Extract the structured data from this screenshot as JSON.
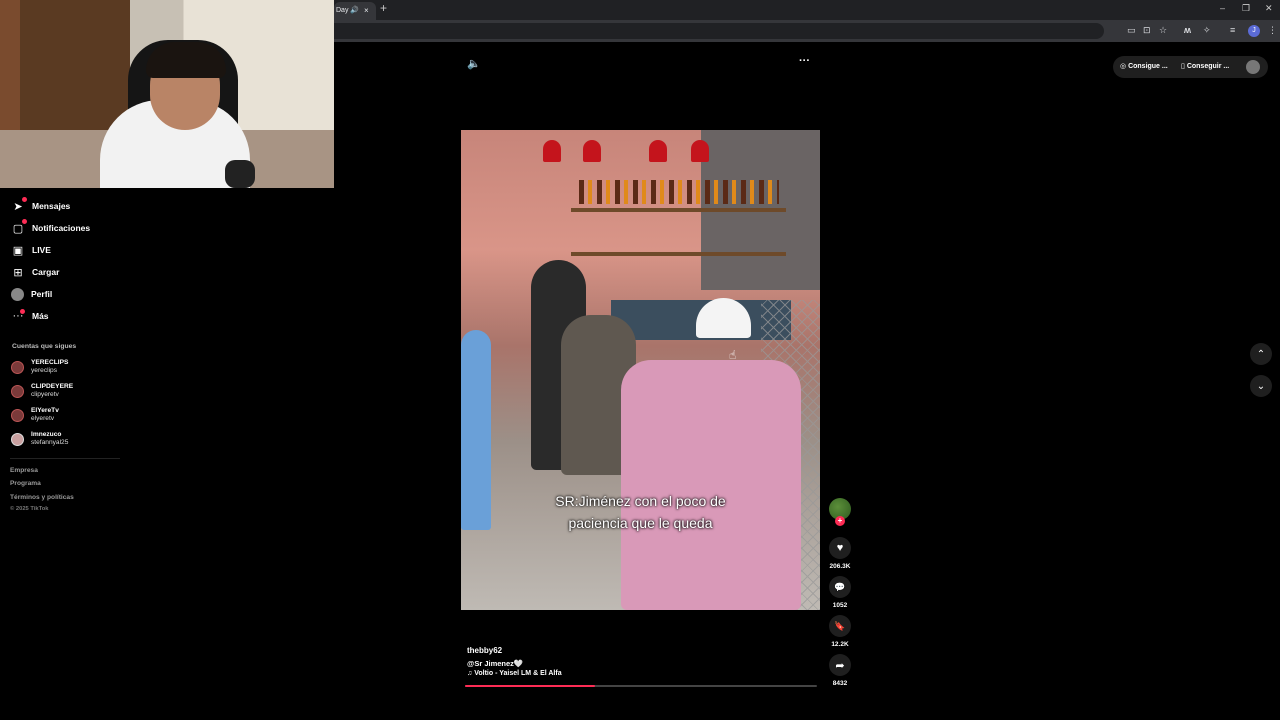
{
  "browser": {
    "tab_title": "Day",
    "speaker_glyph": "🔊",
    "close_glyph": "×",
    "new_tab_glyph": "+",
    "win_min": "–",
    "win_max": "❐",
    "win_close": "✕"
  },
  "toolbar_icons": [
    "cast-icon",
    "translate-icon",
    "star-icon",
    "extension-m-icon",
    "puzzle-icon",
    "tab-search-icon",
    "profile-icon",
    "menu-dots-icon"
  ],
  "toolbar": {
    "profile_letter": "J",
    "menu_glyph": "⋮"
  },
  "sidebar": {
    "items": [
      {
        "label": "Mensajes",
        "icon": "➤"
      },
      {
        "label": "Notificaciones",
        "icon": "▢"
      },
      {
        "label": "LIVE",
        "icon": "▣"
      },
      {
        "label": "Cargar",
        "icon": "⊞"
      },
      {
        "label": "Perfil",
        "icon": ""
      },
      {
        "label": "Más",
        "icon": "···"
      }
    ],
    "following_title": "Cuentas que sigues",
    "accounts": [
      {
        "name": "YERECLIPS",
        "handle": "yereclips"
      },
      {
        "name": "CLIPDEYERE",
        "handle": "clipyeretv"
      },
      {
        "name": "ElYereTv",
        "handle": "elyeretv"
      },
      {
        "name": "Imnezuco",
        "handle": "stefannyal25"
      }
    ],
    "footer": [
      "Empresa",
      "Programa",
      "Términos y políticas"
    ],
    "copyright": "© 2025 TikTok"
  },
  "top": {
    "volume_glyph": "🔈",
    "more_glyph": "···",
    "pill_1": "Consigue ...",
    "pill_2": "Conseguir ...",
    "pill_1_icon": "◎",
    "pill_2_icon": "▯"
  },
  "video": {
    "caption_line1": "SR:Jiménez con el poco de",
    "caption_line2": "paciencia que le queda",
    "progress_fraction": 0.37
  },
  "info": {
    "author": "thebby62",
    "description": "@Sr Jimenez🤍",
    "music_icon": "♫",
    "music": "Voltio - Yaisel LM & El Alfa"
  },
  "actions": {
    "follow_glyph": "+",
    "like": {
      "glyph": "♥",
      "count": "206.3K"
    },
    "comment": {
      "glyph": "💬",
      "count": "1052"
    },
    "save": {
      "glyph": "🔖",
      "count": "12.2K"
    },
    "share": {
      "glyph": "➦",
      "count": "8432"
    }
  },
  "navigation": {
    "up_glyph": "⌃",
    "down_glyph": "⌄"
  },
  "colors": {
    "accent": "#fe2c55",
    "background": "#000000"
  }
}
